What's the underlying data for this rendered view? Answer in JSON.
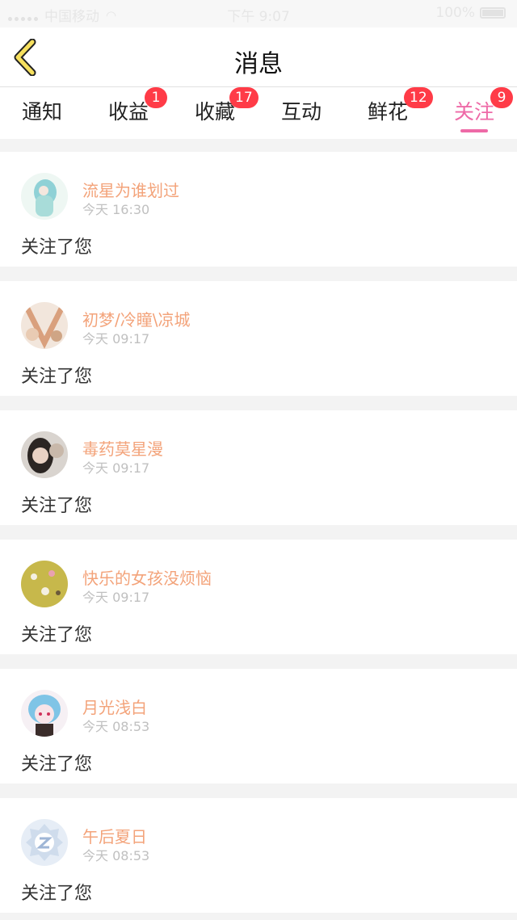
{
  "status_bar": {
    "carrier": "中国移动",
    "time": "下午 9:07",
    "battery": "100%"
  },
  "header": {
    "title": "消息",
    "back_icon": "chevron-left-icon"
  },
  "tabs": [
    {
      "label": "通知",
      "badge": ""
    },
    {
      "label": "收益",
      "badge": "1"
    },
    {
      "label": "收藏",
      "badge": "17"
    },
    {
      "label": "互动",
      "badge": ""
    },
    {
      "label": "鲜花",
      "badge": "12"
    },
    {
      "label": "关注",
      "badge": "9",
      "active": true
    }
  ],
  "colors": {
    "accent": "#ee6aa7",
    "username": "#f3a37a",
    "badge": "#ff3b47",
    "back_icon_fill": "#f6e05e"
  },
  "notifications": [
    {
      "name": "流星为谁划过",
      "time": "今天 16:30",
      "action": "关注了您"
    },
    {
      "name": "初梦/冷瞳\\凉城",
      "time": "今天 09:17",
      "action": "关注了您"
    },
    {
      "name": "毒药莫星漫",
      "time": "今天 09:17",
      "action": "关注了您"
    },
    {
      "name": "快乐的女孩没烦恼",
      "time": "今天 09:17",
      "action": "关注了您"
    },
    {
      "name": "月光浅白",
      "time": "今天 08:53",
      "action": "关注了您"
    },
    {
      "name": "午后夏日",
      "time": "今天 08:53",
      "action": "关注了您"
    }
  ]
}
